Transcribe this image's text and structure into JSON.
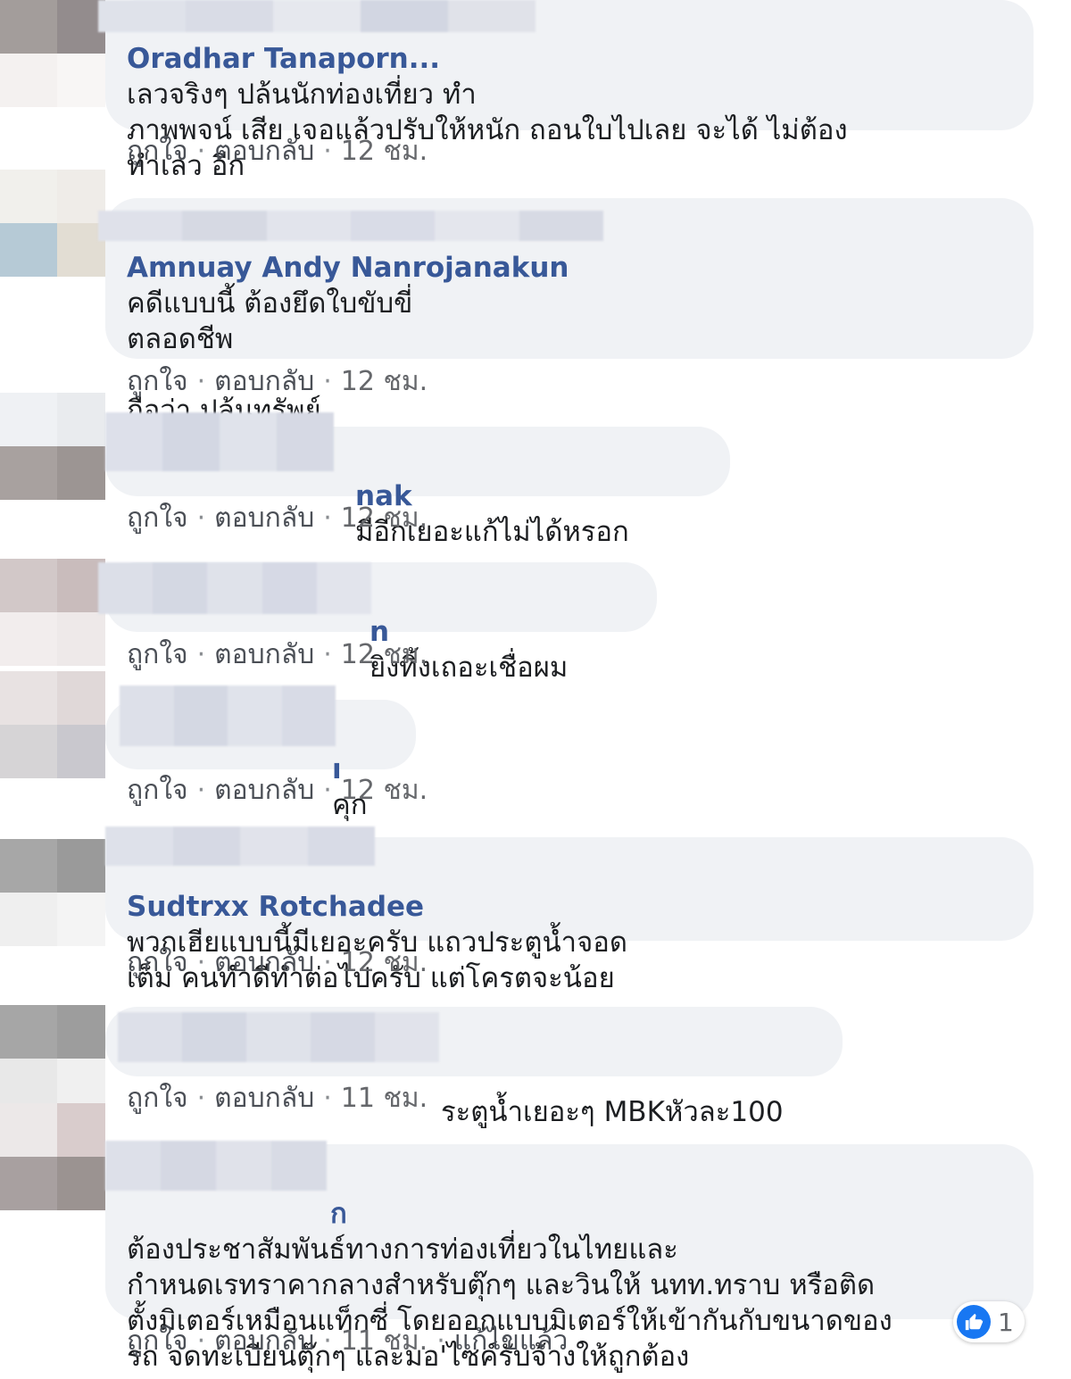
{
  "actions": {
    "like": "ถูกใจ",
    "reply": "ตอบกลับ",
    "separator": "·",
    "edited": "แก้ไขแล้ว"
  },
  "comments": [
    {
      "name": "Oradhar Tanaporn...",
      "text": "เลวจริงๆ ปล้นนักท่องเที่ยว ทำ\nภาพพจน์ เสีย เจอแล้วปรับให้หนัก ถอนใบไปเลย จะได้ ไม่ต้อง\nทำเลว อีก",
      "time": "12 ชม."
    },
    {
      "name": "Amnuay Andy Nanrojanakun",
      "text": "คดีแบบนี้ ต้องยึดใบขับขี่\nตลอดชีพ\n\nถือว่า ปล้นทรัพย์",
      "time": "12 ชม."
    },
    {
      "name": "nak",
      "text": "มีอีกเยอะแก้ไม่ได้หรอก",
      "time": "12 ชม."
    },
    {
      "name": "n",
      "text": "ยิงทิ้งเถอะเชื่อผม",
      "time": "12 ชม."
    },
    {
      "name": "ı",
      "text": "คุก",
      "time": "12 ชม."
    },
    {
      "name": "Sudtrxx Rotchadee",
      "text": "พวกเฮียแบบนี้มีเยอะครับ แถวประตูน้ำจอด\nเต็ม คนทำดีทำต่อไปครับ แต่โครตจะน้อย",
      "time": "12 ชม."
    },
    {
      "name": "",
      "text": "ระตูน้ำเยอะๆ MBKหัวละ100",
      "time": "11 ชม."
    },
    {
      "name": "ก",
      "text": "ต้องประชาสัมพันธ์ทางการท่องเที่ยวในไทยและ\nกำหนดเรทราคากลางสำหรับตุ๊กๆ และวินให้ นทท.ทราบ หรือติด\nตั้งมิเตอร์เหมือนแท็กซี่ โดยออกแบบมิเตอร์ให้เข้ากันกับขนาดของ\nรถ จดทะเบียนตุ๊กๆ และมอ'ไซค์รับจ้างให้ถูกต้อง",
      "time": "11 ชม.",
      "reactions": {
        "icon": "thumbs-up-icon",
        "count": "1"
      }
    }
  ]
}
